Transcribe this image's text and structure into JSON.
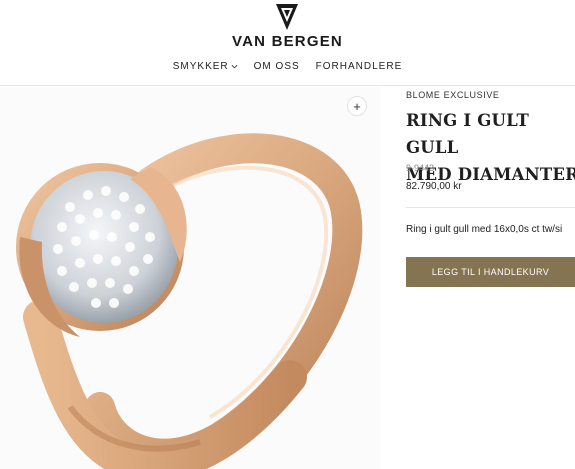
{
  "header": {
    "logo_text": "VAN BERGEN",
    "nav": [
      {
        "label": "SMYKKER",
        "has_dropdown": true
      },
      {
        "label": "OM OSS"
      },
      {
        "label": "FORHANDLERE"
      }
    ]
  },
  "product": {
    "brand": "BLOME EXCLUSIVE",
    "title_line1": "RING I GULT GULL",
    "title_line2": "MED DIAMANTER",
    "sku": "9-9443",
    "price": "82.790,00 kr",
    "description": "Ring i gult gull med 16x0,0s ct tw/si",
    "add_to_cart_label": "LEGG TIL I HANDLEKURV",
    "zoom_symbol": "+"
  },
  "colors": {
    "button": "#857452",
    "gold": "#d9a77d",
    "diamond": "#d8dce0"
  },
  "icons": [
    "logo-mark-icon",
    "chevron-down-icon",
    "zoom-plus-icon"
  ]
}
